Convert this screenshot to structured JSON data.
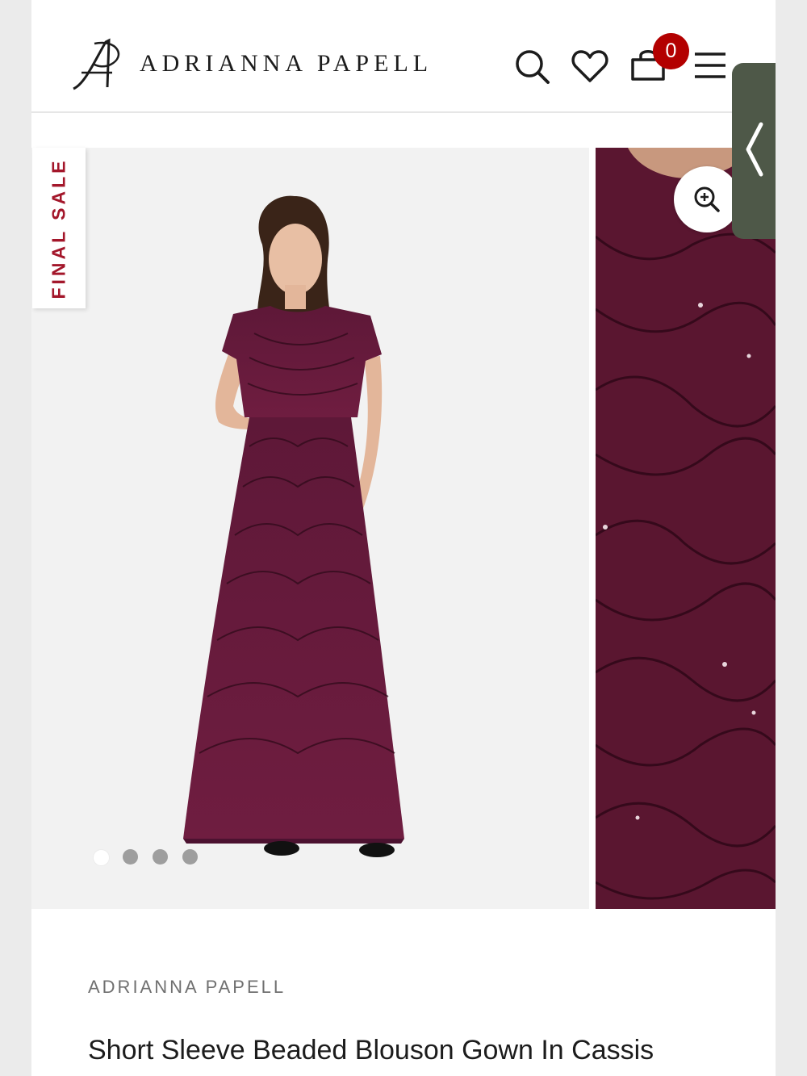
{
  "header": {
    "logo_text": "ADRIANNA PAPELL",
    "cart_count": "0"
  },
  "badges": {
    "final_sale": "FINAL SALE"
  },
  "gallery": {
    "slide_count": 4,
    "active_slide": 1
  },
  "product": {
    "brand": "ADRIANNA PAPELL",
    "title": "Short Sleeve Beaded Blouson Gown In Cassis"
  },
  "colors": {
    "accent_red": "#b30000",
    "final_sale_red": "#a3162a",
    "gown_color": "#5a1630",
    "side_tab": "#4e5848"
  }
}
